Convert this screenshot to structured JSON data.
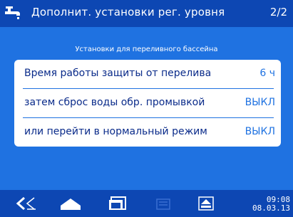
{
  "header": {
    "title": "Дополнит. установки рег. уровня",
    "page_indicator": "2/2",
    "icon": "faucet-icon"
  },
  "subtitle": "Установки для переливного бассейна",
  "settings": [
    {
      "label": "Время работы защиты от перелива",
      "value": "6 ч"
    },
    {
      "label": "затем сброс воды обр. промывкой",
      "value": "ВЫКЛ"
    },
    {
      "label": "или перейти в нормальный режим",
      "value": "ВЫКЛ"
    }
  ],
  "footer": {
    "buttons": [
      "back-icon",
      "home-icon",
      "windows-icon",
      "menu-icon",
      "eject-icon"
    ],
    "time": "09:08",
    "date": "08.03.13"
  },
  "colors": {
    "background": "#1f72e1",
    "bar": "#0d47b3",
    "label_text": "#0a2b8a",
    "value_text": "#1f72e1"
  }
}
